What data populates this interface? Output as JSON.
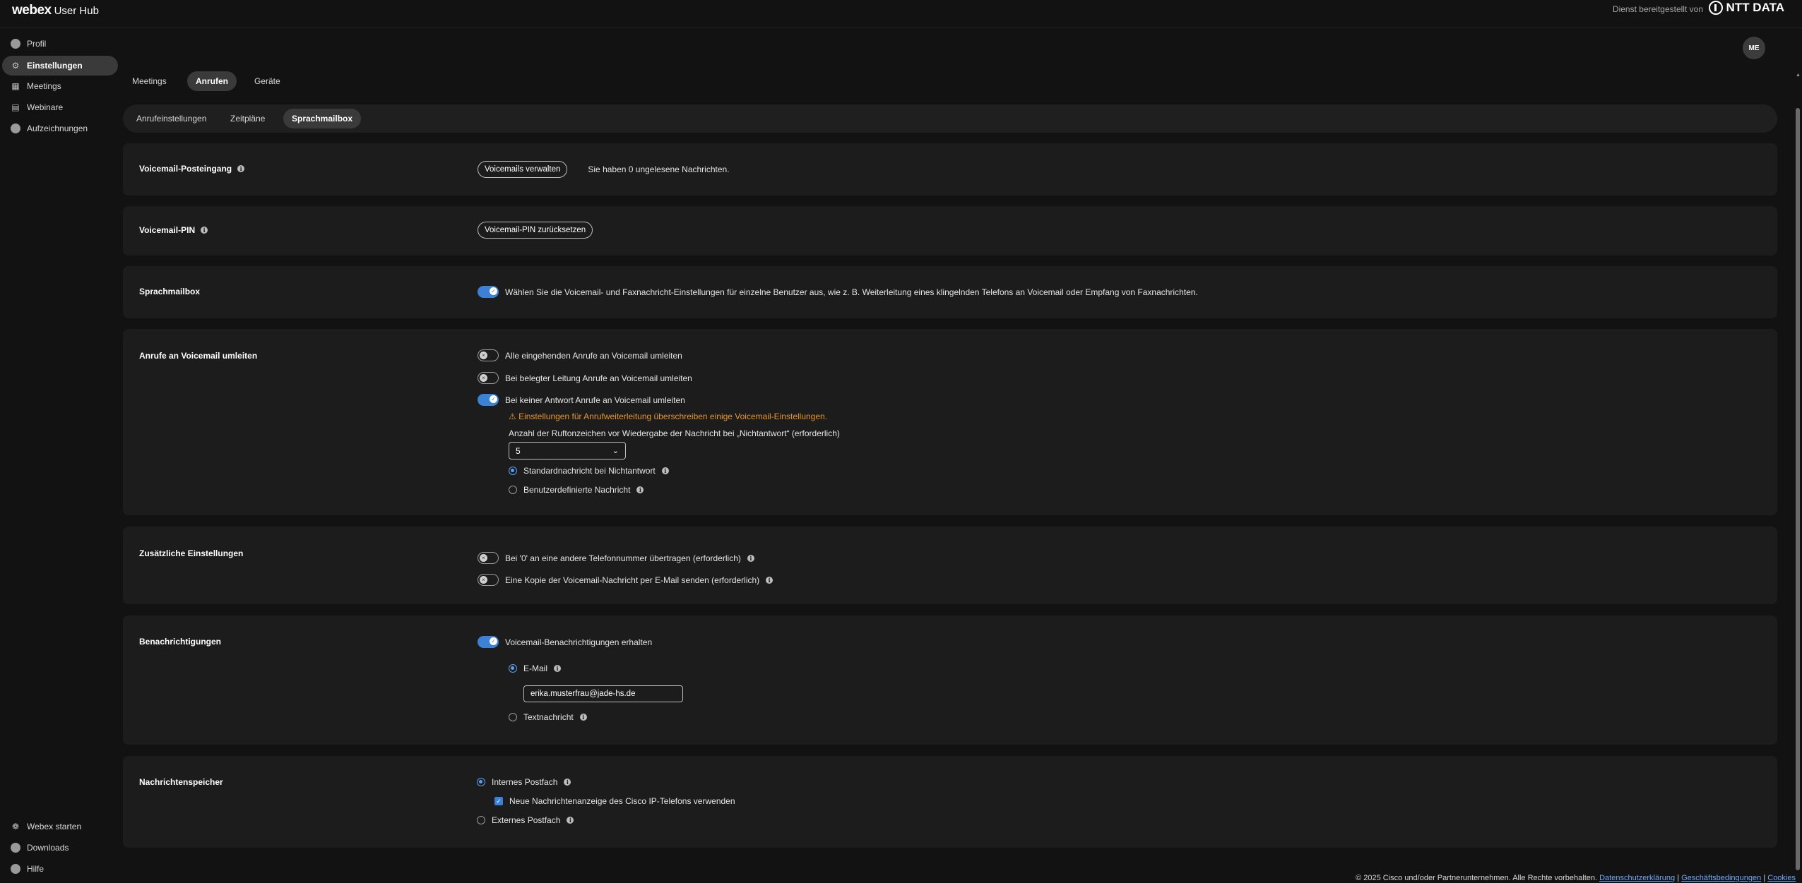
{
  "header": {
    "brand_bold": "webex",
    "brand_rest": "User Hub",
    "provided_by": "Dienst bereitgestellt von",
    "partner_logo": "NTT DATA"
  },
  "avatar": {
    "initials": "ME"
  },
  "sidebar": {
    "items": [
      {
        "label": "Profil",
        "icon": "profile-icon"
      },
      {
        "label": "Einstellungen",
        "icon": "gear-icon",
        "active": true
      },
      {
        "label": "Meetings",
        "icon": "calendar-icon"
      },
      {
        "label": "Webinare",
        "icon": "webinar-icon"
      },
      {
        "label": "Aufzeichnungen",
        "icon": "recordings-icon"
      }
    ],
    "bottom": [
      {
        "label": "Webex starten",
        "icon": "webex-icon"
      },
      {
        "label": "Downloads",
        "icon": "download-icon"
      },
      {
        "label": "Hilfe",
        "icon": "help-icon"
      }
    ]
  },
  "tabs": [
    "Meetings",
    "Anrufen",
    "Geräte"
  ],
  "active_tab": "Anrufen",
  "subtabs": [
    "Anrufeinstellungen",
    "Zeitpläne",
    "Sprachmailbox"
  ],
  "active_subtab": "Sprachmailbox",
  "inbox": {
    "title": "Voicemail-Posteingang",
    "button": "Voicemails verwalten",
    "status": "Sie haben 0 ungelesene Nachrichten."
  },
  "pin": {
    "title": "Voicemail-PIN",
    "button": "Voicemail-PIN zurücksetzen"
  },
  "mailbox": {
    "title": "Sprachmailbox",
    "toggle_on": true,
    "description": "Wählen Sie die Voicemail- und Faxnachricht-Einstellungen für einzelne Benutzer aus, wie z. B. Weiterleitung eines klingelnden Telefons an Voicemail oder Empfang von Faxnachrichten."
  },
  "redirect": {
    "title": "Anrufe an Voicemail umleiten",
    "options": [
      {
        "label": "Alle eingehenden Anrufe an Voicemail umleiten",
        "on": false
      },
      {
        "label": "Bei belegter Leitung Anrufe an Voicemail umleiten",
        "on": false
      },
      {
        "label": "Bei keiner Antwort Anrufe an Voicemail umleiten",
        "on": true
      }
    ],
    "warning": "⚠ Einstellungen für Anrufweiterleitung überschreiben einige Voicemail-Einstellungen.",
    "rings_label": "Anzahl der Ruftonzeichen vor Wiedergabe der Nachricht bei „Nichtantwort“ (erforderlich)",
    "rings_value": "5",
    "message_options": [
      {
        "label": "Standardnachricht bei Nichtantwort",
        "selected": true
      },
      {
        "label": "Benutzerdefinierte Nachricht",
        "selected": false
      }
    ]
  },
  "additional": {
    "title": "Zusätzliche Einstellungen",
    "options": [
      {
        "label": "Bei '0' an eine andere Telefonnummer übertragen (erforderlich)",
        "on": false
      },
      {
        "label": "Eine Kopie der Voicemail-Nachricht per E-Mail senden (erforderlich)",
        "on": false
      }
    ]
  },
  "notifications": {
    "title": "Benachrichtigungen",
    "toggle_label": "Voicemail-Benachrichtigungen erhalten",
    "toggle_on": true,
    "email_label": "E-Mail",
    "email_value": "erika.musterfrau@jade-hs.de",
    "text_label": "Textnachricht"
  },
  "storage": {
    "title": "Nachrichtenspeicher",
    "internal_label": "Internes Postfach",
    "indicator_label": "Neue Nachrichtenanzeige des Cisco IP-Telefons verwenden",
    "external_label": "Externes Postfach"
  },
  "footer": {
    "copyright": "© 2025 Cisco und/oder Partnerunternehmen. Alle Rechte vorbehalten.",
    "privacy": "Datenschutzerklärung",
    "terms": "Geschäftsbedingungen",
    "cookies": "Cookies"
  },
  "colors": {
    "accent": "#3b82d6",
    "warning": "#e6962f",
    "link": "#6fa8ff"
  }
}
